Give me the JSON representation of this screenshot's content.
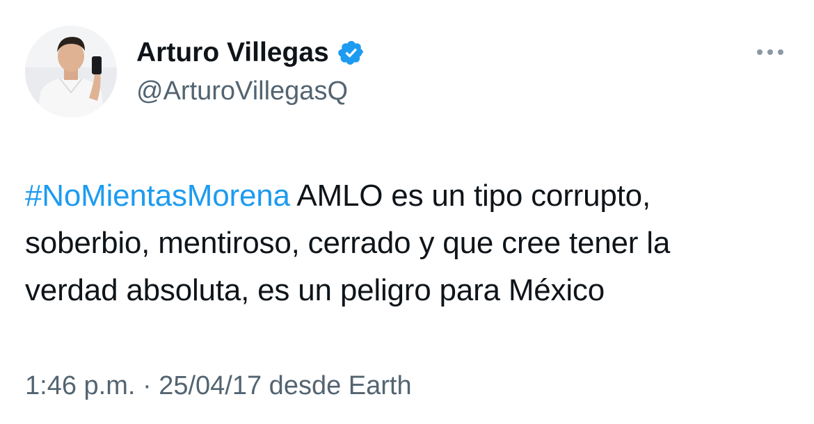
{
  "tweet": {
    "author": {
      "display_name": "Arturo Villegas",
      "handle": "@ArturoVillegasQ",
      "verified": true,
      "verified_color": "#1d9bf0"
    },
    "more_icon": "ellipsis-horizontal-icon",
    "body": {
      "hashtag": "#NoMientasMorena",
      "line1_rest": " AMLO es un tipo corrupto,",
      "line2": "soberbio, mentiroso, cerrado y que cree tener la",
      "line3": "verdad absoluta, es un peligro para México"
    },
    "meta": {
      "time": "1:46 p.m.",
      "separator": " · ",
      "date": "25/04/17",
      "source": " desde Earth"
    }
  },
  "colors": {
    "text": "#0f1419",
    "secondary": "#536471",
    "accent": "#1d9bf0"
  }
}
